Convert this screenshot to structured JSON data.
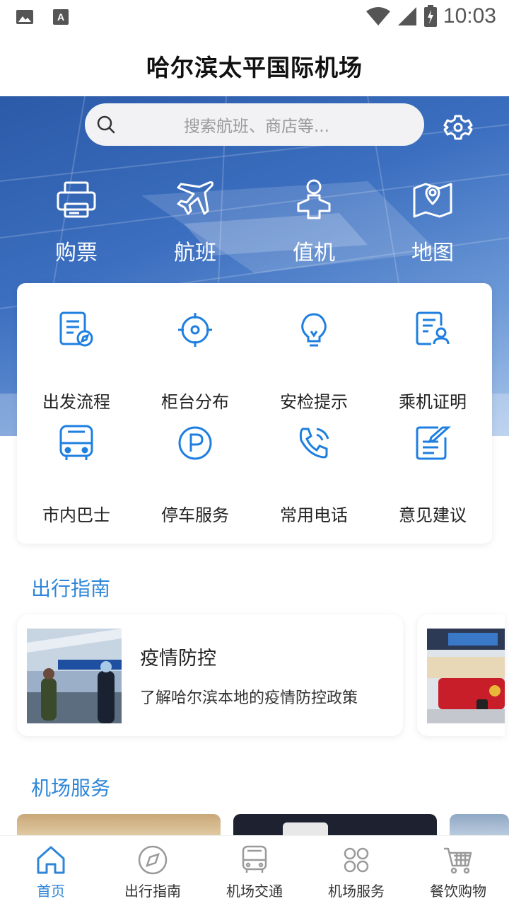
{
  "status_bar": {
    "time": "10:03"
  },
  "header": {
    "title": "哈尔滨太平国际机场"
  },
  "search": {
    "placeholder": "搜索航班、商店等..."
  },
  "quick_actions": [
    {
      "label": "购票",
      "icon": "printer-icon"
    },
    {
      "label": "航班",
      "icon": "airplane-icon"
    },
    {
      "label": "值机",
      "icon": "checkin-person-icon"
    },
    {
      "label": "地图",
      "icon": "map-pin-icon"
    }
  ],
  "services": [
    {
      "label": "出发流程",
      "icon": "document-compass-icon"
    },
    {
      "label": "柜台分布",
      "icon": "crosshair-icon"
    },
    {
      "label": "安检提示",
      "icon": "lightbulb-icon"
    },
    {
      "label": "乘机证明",
      "icon": "document-user-icon"
    },
    {
      "label": "市内巴士",
      "icon": "bus-icon"
    },
    {
      "label": "停车服务",
      "icon": "parking-icon"
    },
    {
      "label": "常用电话",
      "icon": "phone-icon"
    },
    {
      "label": "意见建议",
      "icon": "edit-note-icon"
    }
  ],
  "travel_guide": {
    "title": "出行指南",
    "cards": [
      {
        "title": "疫情防控",
        "desc": "了解哈尔滨本地的疫情防控政策"
      }
    ]
  },
  "airport_services": {
    "title": "机场服务"
  },
  "bottom_nav": [
    {
      "label": "首页",
      "icon": "home-icon",
      "active": true
    },
    {
      "label": "出行指南",
      "icon": "compass-icon",
      "active": false
    },
    {
      "label": "机场交通",
      "icon": "bus-icon",
      "active": false
    },
    {
      "label": "机场服务",
      "icon": "clover-icon",
      "active": false
    },
    {
      "label": "餐饮购物",
      "icon": "cart-icon",
      "active": false
    }
  ],
  "colors": {
    "accent": "#2f86d8",
    "hero": "#3c6fc0"
  }
}
